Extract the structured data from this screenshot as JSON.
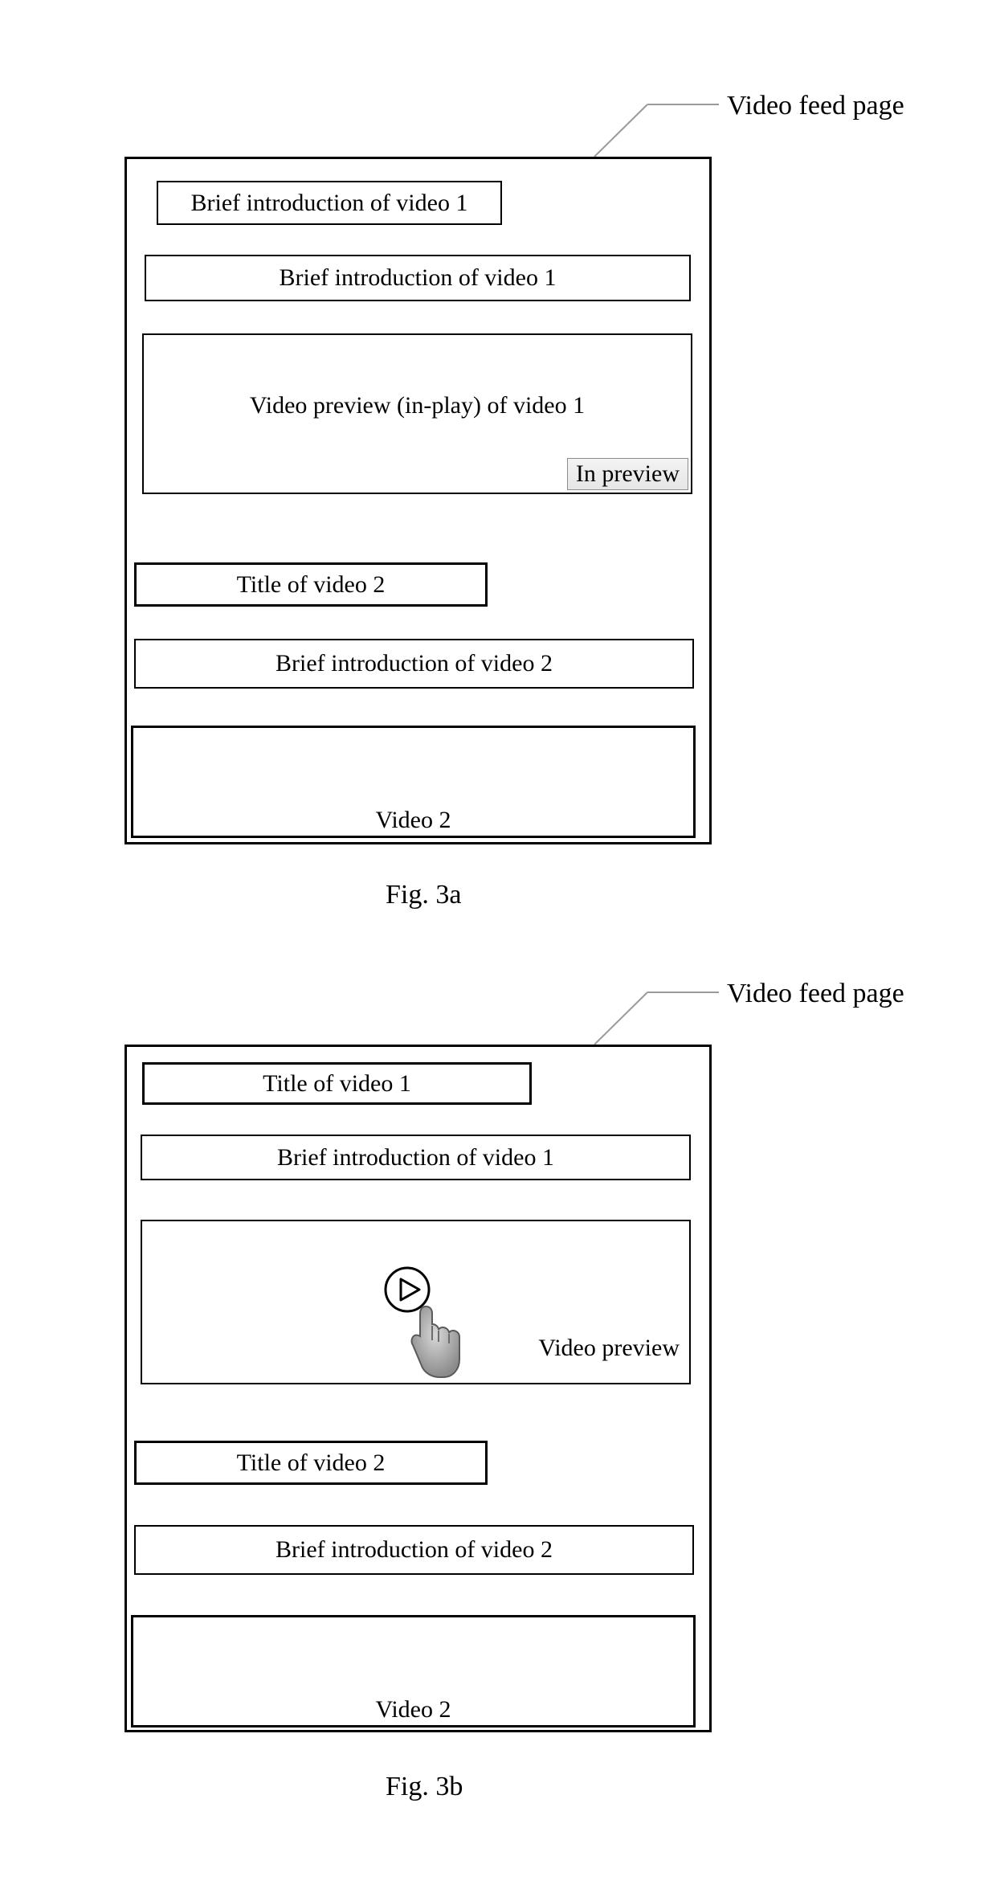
{
  "fig_a": {
    "callout": "Video feed page",
    "box1": "Brief introduction of video 1",
    "box2": "Brief introduction of video 1",
    "preview_text": "Video preview (in-play) of video 1",
    "tag": "In preview",
    "title2": "Title of video 2",
    "intro2": "Brief introduction of video 2",
    "video2": "Video 2",
    "caption": "Fig. 3a"
  },
  "fig_b": {
    "callout": "Video feed page",
    "title1": "Title of video 1",
    "intro1": "Brief introduction of video 1",
    "preview_label": "Video preview",
    "title2": "Title of video 2",
    "intro2": "Brief introduction of video 2",
    "video2": "Video 2",
    "caption": "Fig. 3b"
  }
}
